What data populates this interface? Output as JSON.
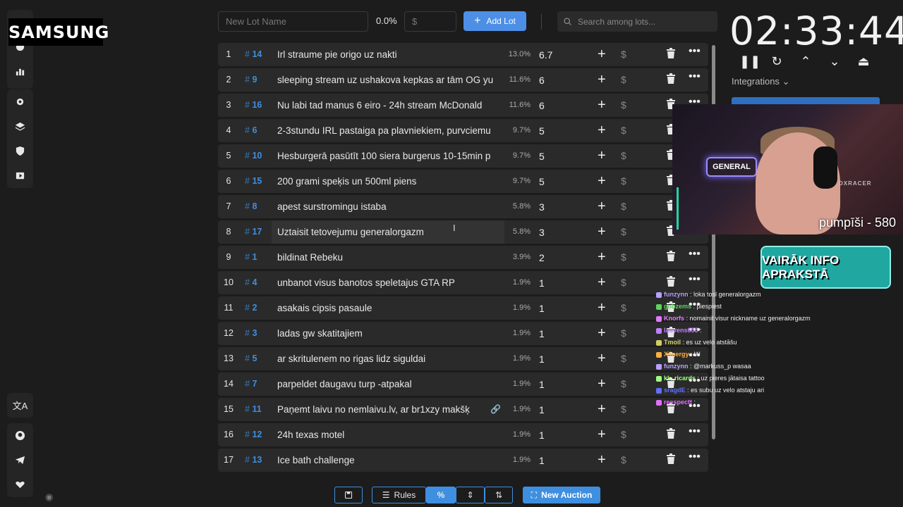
{
  "overlay": {
    "brand_logo": "SAMSUNG"
  },
  "sidebar": {
    "top_icons": [
      "list-icon",
      "chart-icon",
      "stats-icon"
    ],
    "mid_icons": [
      "gear-icon",
      "layers-icon",
      "shield-icon",
      "video-icon"
    ],
    "lang_icon": "translate-icon",
    "bottom_icons": [
      "github-icon",
      "telegram-icon",
      "donate-icon"
    ]
  },
  "topbar": {
    "lot_name_placeholder": "New Lot Name",
    "percent": "0.0%",
    "amount_placeholder": "$",
    "add_lot_label": "Add Lot",
    "search_placeholder": "Search among lots..."
  },
  "lots": [
    {
      "index": "1",
      "id": "14",
      "name": "Irl straume pie origo uz nakti",
      "pct": "13.0%",
      "amount": "6.7"
    },
    {
      "index": "2",
      "id": "9",
      "name": "sleeping stream uz ushakova kepkas ar tām OG yu",
      "pct": "11.6%",
      "amount": "6"
    },
    {
      "index": "3",
      "id": "16",
      "name": "Nu labi tad manus 6 eiro - 24h stream McDonald",
      "pct": "11.6%",
      "amount": "6"
    },
    {
      "index": "4",
      "id": "6",
      "name": "2-3stundu IRL pastaiga pa plavniekiem, purvciemu",
      "pct": "9.7%",
      "amount": "5"
    },
    {
      "index": "5",
      "id": "10",
      "name": "Hesburgerā pasūtīt 100 siera burgerus 10-15min p",
      "pct": "9.7%",
      "amount": "5"
    },
    {
      "index": "6",
      "id": "15",
      "name": "200 grami speķis un 500ml piens",
      "pct": "9.7%",
      "amount": "5"
    },
    {
      "index": "7",
      "id": "8",
      "name": "apest surstromingu istaba",
      "pct": "5.8%",
      "amount": "3"
    },
    {
      "index": "8",
      "id": "17",
      "name": "Uztaisit tetovejumu generalorgazm",
      "pct": "5.8%",
      "amount": "3"
    },
    {
      "index": "9",
      "id": "1",
      "name": "bildinat Rebeku",
      "pct": "3.9%",
      "amount": "2"
    },
    {
      "index": "10",
      "id": "4",
      "name": "unbanot visus banotos speletajus GTA RP",
      "pct": "1.9%",
      "amount": "1"
    },
    {
      "index": "11",
      "id": "2",
      "name": "asakais cipsis pasaule",
      "pct": "1.9%",
      "amount": "1"
    },
    {
      "index": "12",
      "id": "3",
      "name": "ladas gw skatitajiem",
      "pct": "1.9%",
      "amount": "1"
    },
    {
      "index": "13",
      "id": "5",
      "name": "ar skritulenem no rigas lidz siguldai",
      "pct": "1.9%",
      "amount": "1"
    },
    {
      "index": "14",
      "id": "7",
      "name": "parpeldet daugavu turp -atpakal",
      "pct": "1.9%",
      "amount": "1"
    },
    {
      "index": "15",
      "id": "11",
      "name": "Paņemt laivu no nemlaivu.lv, ar br1xzy makšķ",
      "pct": "1.9%",
      "amount": "1"
    },
    {
      "index": "16",
      "id": "12",
      "name": "24h texas motel",
      "pct": "1.9%",
      "amount": "1"
    },
    {
      "index": "17",
      "id": "13",
      "name": "Ice bath challenge",
      "pct": "1.9%",
      "amount": "1"
    }
  ],
  "toolbar": {
    "rules_label": "Rules",
    "new_auction_label": "New Auction"
  },
  "timer": {
    "display": "02:33:44",
    "integrations_label": "Integrations"
  },
  "stream": {
    "webcam_caption": "pumpīši - 580",
    "neon_sign": "GENERAL",
    "chair_brand": "DXRACER",
    "banner": "VAIRĀK INFO APRAKSTĀ"
  },
  "chat": [
    {
      "user": "funzynn",
      "text": "loka tosl generalorgazm",
      "color": "#b8a0ff"
    },
    {
      "user": "gobzems",
      "text": "piespiest",
      "color": "#5fd35f"
    },
    {
      "user": "Knorfs",
      "text": "nomainit visur nickname uz generalorgazm",
      "color": "#e07bff"
    },
    {
      "user": "lauvens655",
      "text": "",
      "color": "#c080ff"
    },
    {
      "user": "Tmoil",
      "text": "es uz velo atstāšu",
      "color": "#d0d060"
    },
    {
      "user": "Xiinergy",
      "text": "W",
      "color": "#ffb040"
    },
    {
      "user": "funzynn",
      "text": "@markuss_p wasaa",
      "color": "#b8a0ff"
    },
    {
      "user": "kk_ricards",
      "text": "uz pieres jātaisa tattoo",
      "color": "#a0ff80"
    },
    {
      "user": "sragdE",
      "text": "es subu uz velo atstaju ari",
      "color": "#6070ff"
    },
    {
      "user": "reespectt",
      "text": "",
      "color": "#e070ff"
    }
  ],
  "colors": {
    "accent": "#3e8fe0",
    "background": "#1c1c1c",
    "row": "#2a2a2a"
  }
}
